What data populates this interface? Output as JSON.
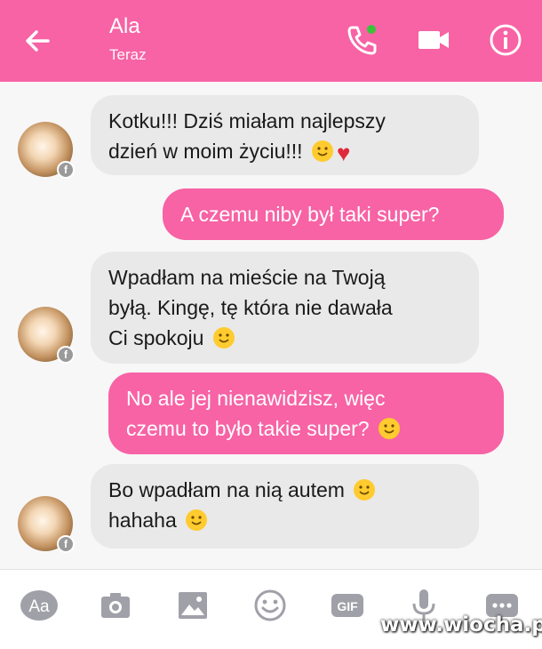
{
  "header": {
    "contact_name": "Ala",
    "status": "Teraz",
    "accent_color": "#f763a5"
  },
  "messages": [
    {
      "sender": "them",
      "lines": [
        "Kotku!!! Dziś miałam najlepszy",
        "dzień w moim życiu!!!"
      ],
      "emojis": [
        "grinning",
        "red-heart"
      ]
    },
    {
      "sender": "me",
      "text": "A czemu niby był taki super?"
    },
    {
      "sender": "them",
      "lines": [
        "Wpadłam na mieście na Twoją",
        "byłą. Kingę, tę która nie dawała",
        "Ci spokoju"
      ],
      "emojis": [
        "tongue"
      ]
    },
    {
      "sender": "me",
      "lines": [
        "No ale jej nienawidzisz, więc",
        "czemu to było takie super?"
      ],
      "emojis": [
        "surprised"
      ]
    },
    {
      "sender": "them",
      "lines": [
        "Bo wpadłam na nią autem",
        "hahaha"
      ],
      "emojis": [
        "grimacing",
        "tongue"
      ]
    }
  ],
  "toolbar": {
    "aa_label": "Aa",
    "gif_label": "GIF"
  },
  "watermark": "www.wiocha.pl"
}
